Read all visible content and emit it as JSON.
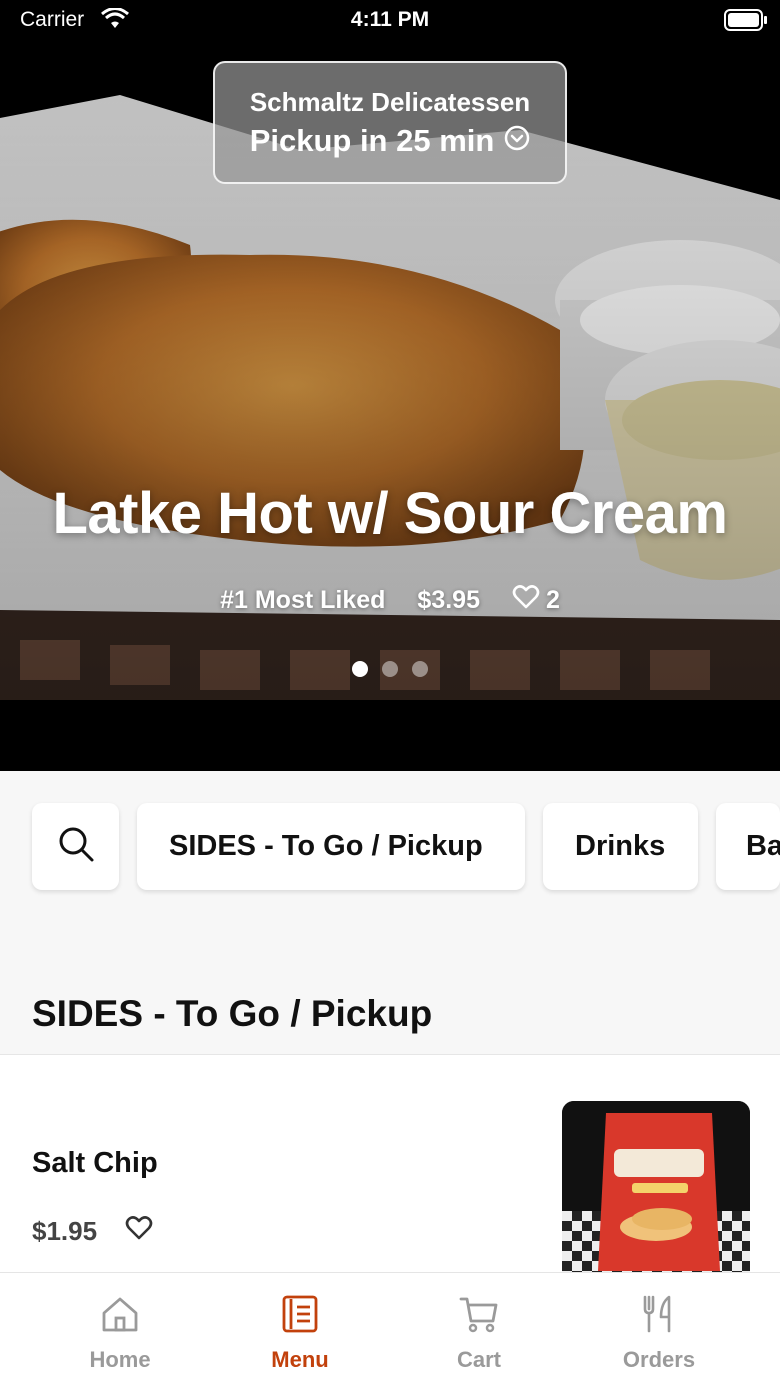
{
  "status_bar": {
    "carrier": "Carrier",
    "time": "4:11 PM"
  },
  "header": {
    "restaurant_name": "Schmaltz Delicatessen",
    "pickup_time": "Pickup in 25 min"
  },
  "hero": {
    "title": "Latke Hot w/ Sour Cream",
    "rank": "#1 Most Liked",
    "price": "$3.95",
    "likes": "2",
    "slide_count": 3,
    "active_slide": 1
  },
  "categories": {
    "search_icon": "search-icon",
    "items": [
      {
        "label": "SIDES - To Go / Pickup"
      },
      {
        "label": "Drinks"
      },
      {
        "label": "Ba"
      }
    ]
  },
  "section": {
    "title": "SIDES - To Go / Pickup"
  },
  "menu_items": [
    {
      "name": "Salt Chip",
      "price": "$1.95"
    }
  ],
  "tab_bar": {
    "accent_color": "#c2410c",
    "inactive_color": "#9a9a9a",
    "tabs": [
      {
        "label": "Home",
        "icon": "home-icon"
      },
      {
        "label": "Menu",
        "icon": "menu-icon"
      },
      {
        "label": "Cart",
        "icon": "cart-icon"
      },
      {
        "label": "Orders",
        "icon": "orders-icon"
      }
    ],
    "active_tab": "Menu"
  }
}
